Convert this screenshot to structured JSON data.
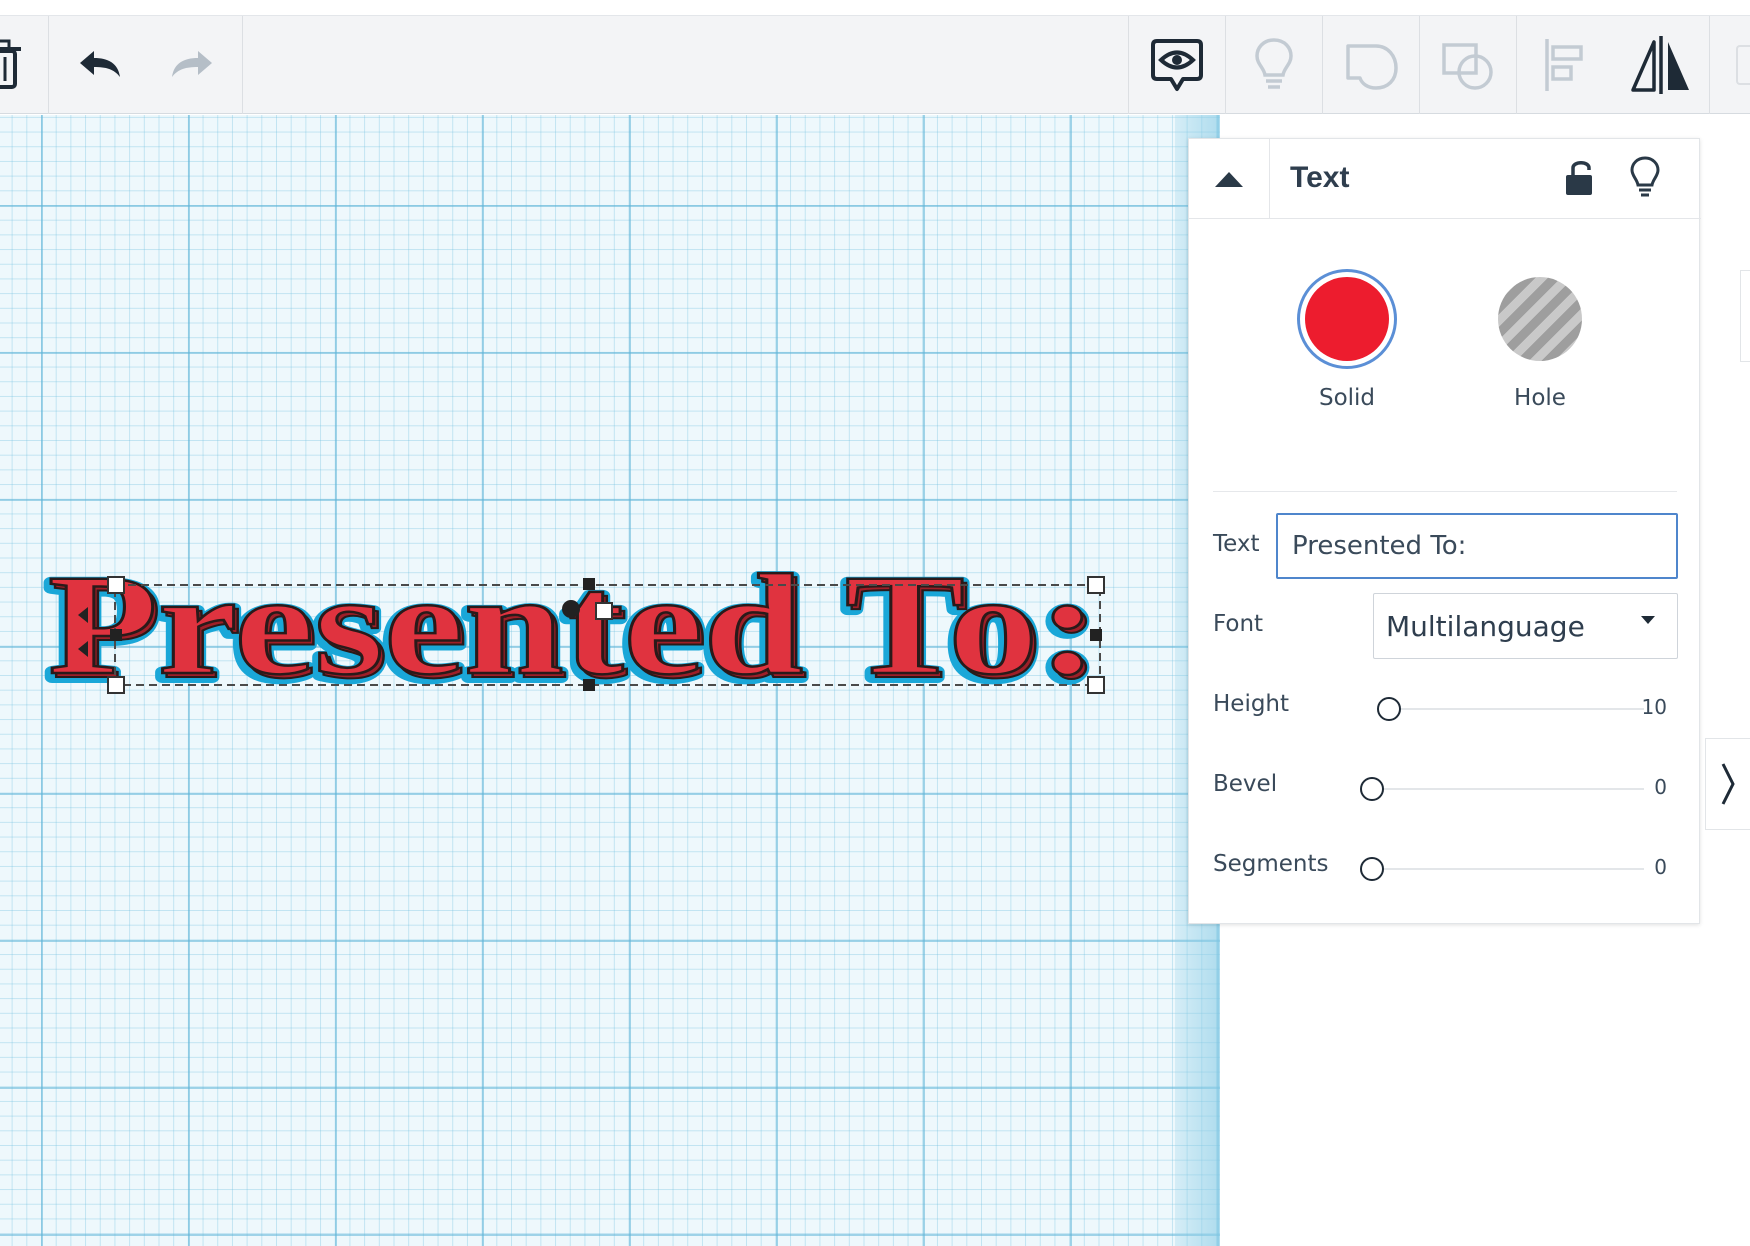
{
  "toolbar": {
    "left_icons": [
      "trash-icon",
      "undo-icon",
      "redo-icon"
    ],
    "right_icons": [
      "note-eye-icon",
      "lightbulb-icon",
      "shape-icon",
      "group-icon",
      "align-icon",
      "mirror-icon"
    ]
  },
  "workplane": {
    "object_text": "Presented To:",
    "object_color": "#e0333f",
    "outline_color": "#1aa7d8"
  },
  "inspector": {
    "title": "Text",
    "lock_icon": "unlock-icon",
    "bulb_icon": "lightbulb-icon",
    "solid_label": "Solid",
    "hole_label": "Hole",
    "solid_color": "#ed1c2e",
    "properties": {
      "text_label": "Text",
      "text_value": "Presented To:",
      "font_label": "Font",
      "font_value": "Multilanguage",
      "height_label": "Height",
      "height_value": "10",
      "bevel_label": "Bevel",
      "bevel_value": "0",
      "segments_label": "Segments",
      "segments_value": "0"
    }
  },
  "side_tab_icon": "chevron-right-icon"
}
